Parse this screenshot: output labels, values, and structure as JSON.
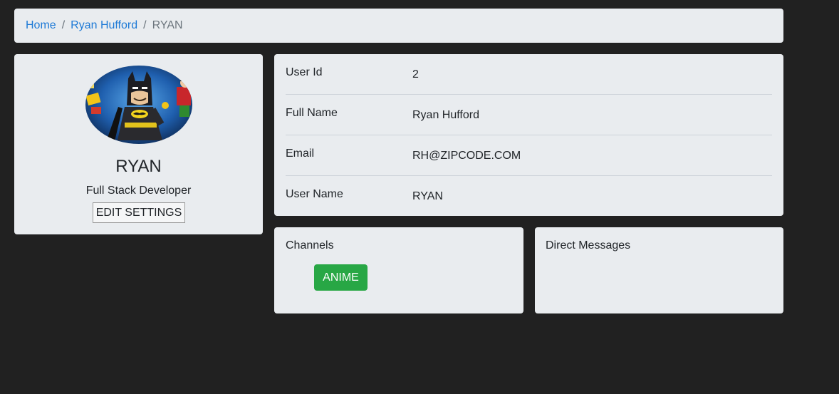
{
  "breadcrumb": {
    "items": [
      "Home",
      "Ryan Hufford"
    ],
    "separator": "/",
    "current": "RYAN"
  },
  "profile": {
    "name": "RYAN",
    "title": "Full Stack Developer",
    "edit_label": "EDIT SETTINGS",
    "avatar_icon": "lego-batman-avatar"
  },
  "info": {
    "rows": [
      {
        "label": "User Id",
        "value": "2"
      },
      {
        "label": "Full Name",
        "value": "Ryan Hufford"
      },
      {
        "label": "Email",
        "value": "RH@ZIPCODE.COM"
      },
      {
        "label": "User Name",
        "value": "RYAN"
      }
    ]
  },
  "channels": {
    "heading": "Channels",
    "items": [
      "ANIME"
    ]
  },
  "direct_messages": {
    "heading": "Direct Messages"
  },
  "colors": {
    "background": "#212121",
    "card": "#e9ecef",
    "link": "#1e7ad6",
    "channel_button": "#28a745"
  }
}
